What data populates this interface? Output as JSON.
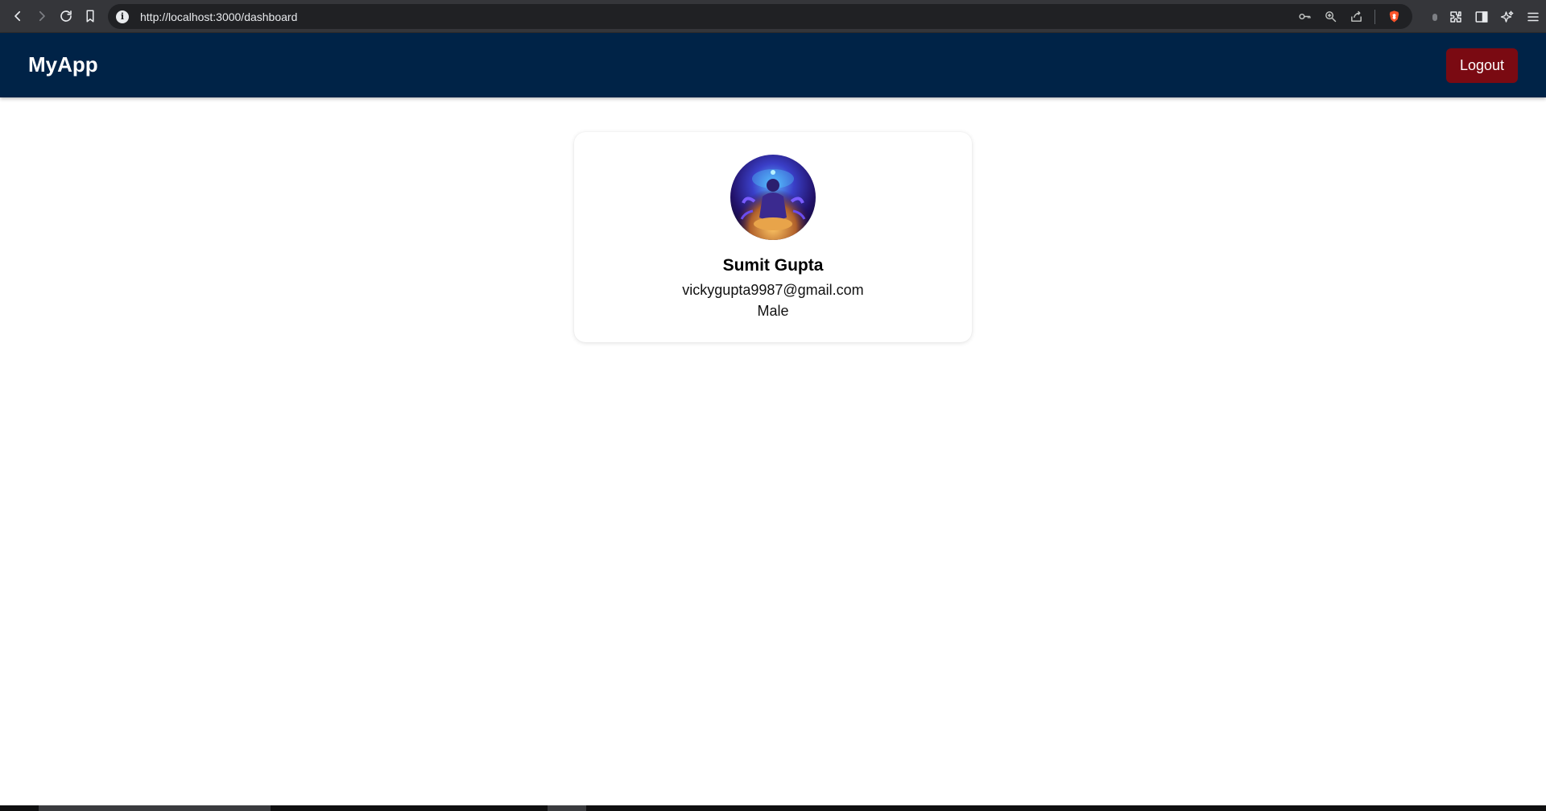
{
  "browser": {
    "url": "http://localhost:3000/dashboard",
    "site_info_glyph": "i",
    "icons": {
      "back": "back-arrow-icon",
      "forward": "forward-arrow-icon",
      "reload": "reload-icon",
      "bookmark": "bookmark-icon",
      "key": "key-icon",
      "zoom": "zoom-icon",
      "share": "share-icon",
      "brave": "brave-shield-icon",
      "extensions": "extensions-icon",
      "sidebar": "sidebar-icon",
      "leo": "leo-ai-icon",
      "menu": "hamburger-menu-icon"
    },
    "colors": {
      "chrome": "#35363a",
      "address": "#202124"
    }
  },
  "navbar": {
    "brand": "MyApp",
    "logout_label": "Logout",
    "colors": {
      "background": "#002347",
      "logout": "#7a0a12"
    }
  },
  "profile": {
    "name": "Sumit Gupta",
    "email": "vickygupta9987@gmail.com",
    "gender": "Male",
    "avatar_alt": "profile-avatar"
  }
}
